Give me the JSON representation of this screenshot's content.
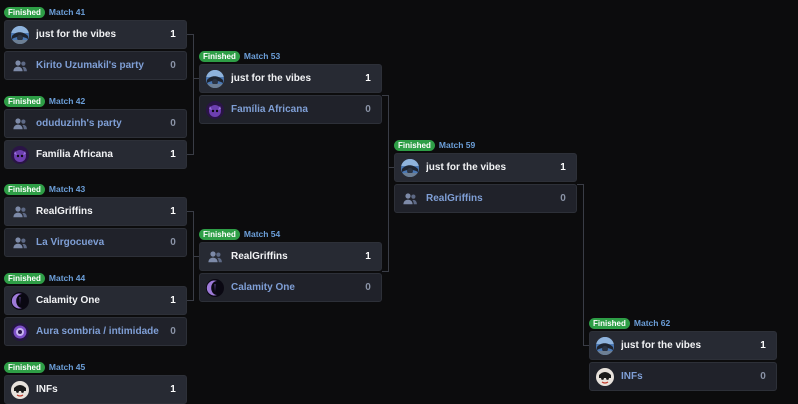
{
  "status_label": "Finished",
  "matches": {
    "m41": {
      "label": "Match 41",
      "p1": {
        "name": "just for the vibes",
        "score": "1",
        "icon": "vibes-avatar"
      },
      "p2": {
        "name": "Kirito Uzumakil's party",
        "score": "0",
        "icon": "party-icon"
      }
    },
    "m42": {
      "label": "Match 42",
      "p1": {
        "name": "oduduzinh's party",
        "score": "0",
        "icon": "party-icon"
      },
      "p2": {
        "name": "Família Africana",
        "score": "1",
        "icon": "familia-avatar"
      }
    },
    "m43": {
      "label": "Match 43",
      "p1": {
        "name": "RealGriffins",
        "score": "1",
        "icon": "party-icon"
      },
      "p2": {
        "name": "La Virgocueva",
        "score": "0",
        "icon": "party-icon"
      }
    },
    "m44": {
      "label": "Match 44",
      "p1": {
        "name": "Calamity One",
        "score": "1",
        "icon": "calamity-avatar"
      },
      "p2": {
        "name": "Aura sombria / intimidade",
        "score": "0",
        "icon": "aura-avatar"
      }
    },
    "m45": {
      "label": "Match 45",
      "p1": {
        "name": "INFs",
        "score": "1",
        "icon": "infs-avatar"
      }
    },
    "m53": {
      "label": "Match 53",
      "p1": {
        "name": "just for the vibes",
        "score": "1",
        "icon": "vibes-avatar"
      },
      "p2": {
        "name": "Família Africana",
        "score": "0",
        "icon": "familia-avatar"
      }
    },
    "m54": {
      "label": "Match 54",
      "p1": {
        "name": "RealGriffins",
        "score": "1",
        "icon": "party-icon"
      },
      "p2": {
        "name": "Calamity One",
        "score": "0",
        "icon": "calamity-avatar"
      }
    },
    "m59": {
      "label": "Match 59",
      "p1": {
        "name": "just for the vibes",
        "score": "1",
        "icon": "vibes-avatar"
      },
      "p2": {
        "name": "RealGriffins",
        "score": "0",
        "icon": "party-icon"
      }
    },
    "m62": {
      "label": "Match 62",
      "p1": {
        "name": "just for the vibes",
        "score": "1",
        "icon": "vibes-avatar"
      },
      "p2": {
        "name": "INFs",
        "score": "0",
        "icon": "infs-avatar"
      }
    }
  }
}
